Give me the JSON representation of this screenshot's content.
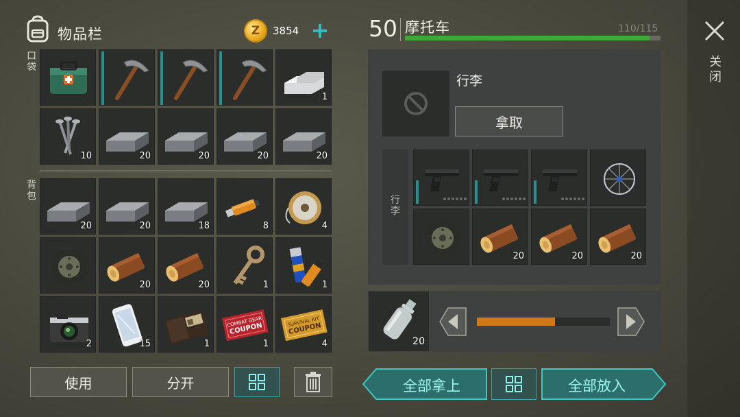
{
  "inventory": {
    "title": "物品栏",
    "coins": "3854",
    "coin_symbol": "Z",
    "plus_label": "+",
    "pocket_label": "口袋",
    "backpack_label": "背包",
    "pocket_slots": [
      {
        "item": "medkit-icon",
        "qty": ""
      },
      {
        "item": "pickaxe-icon",
        "qty": ""
      },
      {
        "item": "pickaxe-icon",
        "qty": ""
      },
      {
        "item": "pickaxe-icon",
        "qty": ""
      },
      {
        "item": "aluminum-ingot-icon",
        "qty": "1"
      },
      {
        "item": "nails-icon",
        "qty": "10"
      },
      {
        "item": "iron-ingot-icon",
        "qty": "20"
      },
      {
        "item": "iron-ingot-icon",
        "qty": "20"
      },
      {
        "item": "iron-ingot-icon",
        "qty": "20"
      },
      {
        "item": "iron-ingot-icon",
        "qty": "20"
      }
    ],
    "backpack_slots": [
      {
        "item": "iron-ingot-icon",
        "qty": "20"
      },
      {
        "item": "iron-ingot-icon",
        "qty": "20"
      },
      {
        "item": "iron-ingot-icon",
        "qty": "18"
      },
      {
        "item": "usb-drive-icon",
        "qty": "8"
      },
      {
        "item": "wire-spool-icon",
        "qty": "4"
      },
      {
        "item": "wheel-icon",
        "qty": ""
      },
      {
        "item": "wood-log-icon",
        "qty": "20"
      },
      {
        "item": "wood-log-icon",
        "qty": "20"
      },
      {
        "item": "key-icon",
        "qty": "1"
      },
      {
        "item": "batteries-icon",
        "qty": "1"
      },
      {
        "item": "camera-icon",
        "qty": "2"
      },
      {
        "item": "smartphone-icon",
        "qty": "15"
      },
      {
        "item": "wallet-icon",
        "qty": "1"
      },
      {
        "item": "combat-coupon-icon",
        "qty": "1"
      },
      {
        "item": "survival-coupon-icon",
        "qty": "4"
      }
    ],
    "buttons": {
      "use": "使用",
      "split": "分开"
    }
  },
  "vehicle": {
    "level": "50",
    "name": "摩托车",
    "capacity_text": "110/115",
    "capacity_fraction": 0.957,
    "luggage_title": "行李",
    "take_button": "拿取",
    "cargo_side_label": "行李",
    "cargo_slots": [
      {
        "item": "pistol-icon",
        "qty": ""
      },
      {
        "item": "pistol-icon",
        "qty": ""
      },
      {
        "item": "pistol-icon",
        "qty": ""
      },
      {
        "item": "bicycle-wheel-icon",
        "qty": ""
      },
      {
        "item": "wheel-icon",
        "qty": ""
      },
      {
        "item": "wood-log-icon",
        "qty": "20"
      },
      {
        "item": "wood-log-icon",
        "qty": "20"
      },
      {
        "item": "wood-log-icon",
        "qty": "20"
      }
    ],
    "fuel": {
      "item": "water-bottle-icon",
      "qty": "20",
      "fill_fraction": 0.59
    },
    "buttons": {
      "take_all": "全部拿上",
      "put_all": "全部放入"
    }
  },
  "close": {
    "label": "关闭"
  },
  "colors": {
    "accent_teal": "#2eaaa8",
    "capacity_green": "#3fa83a",
    "fuel_orange": "#d07818",
    "coupon_red": "#b8242c"
  }
}
